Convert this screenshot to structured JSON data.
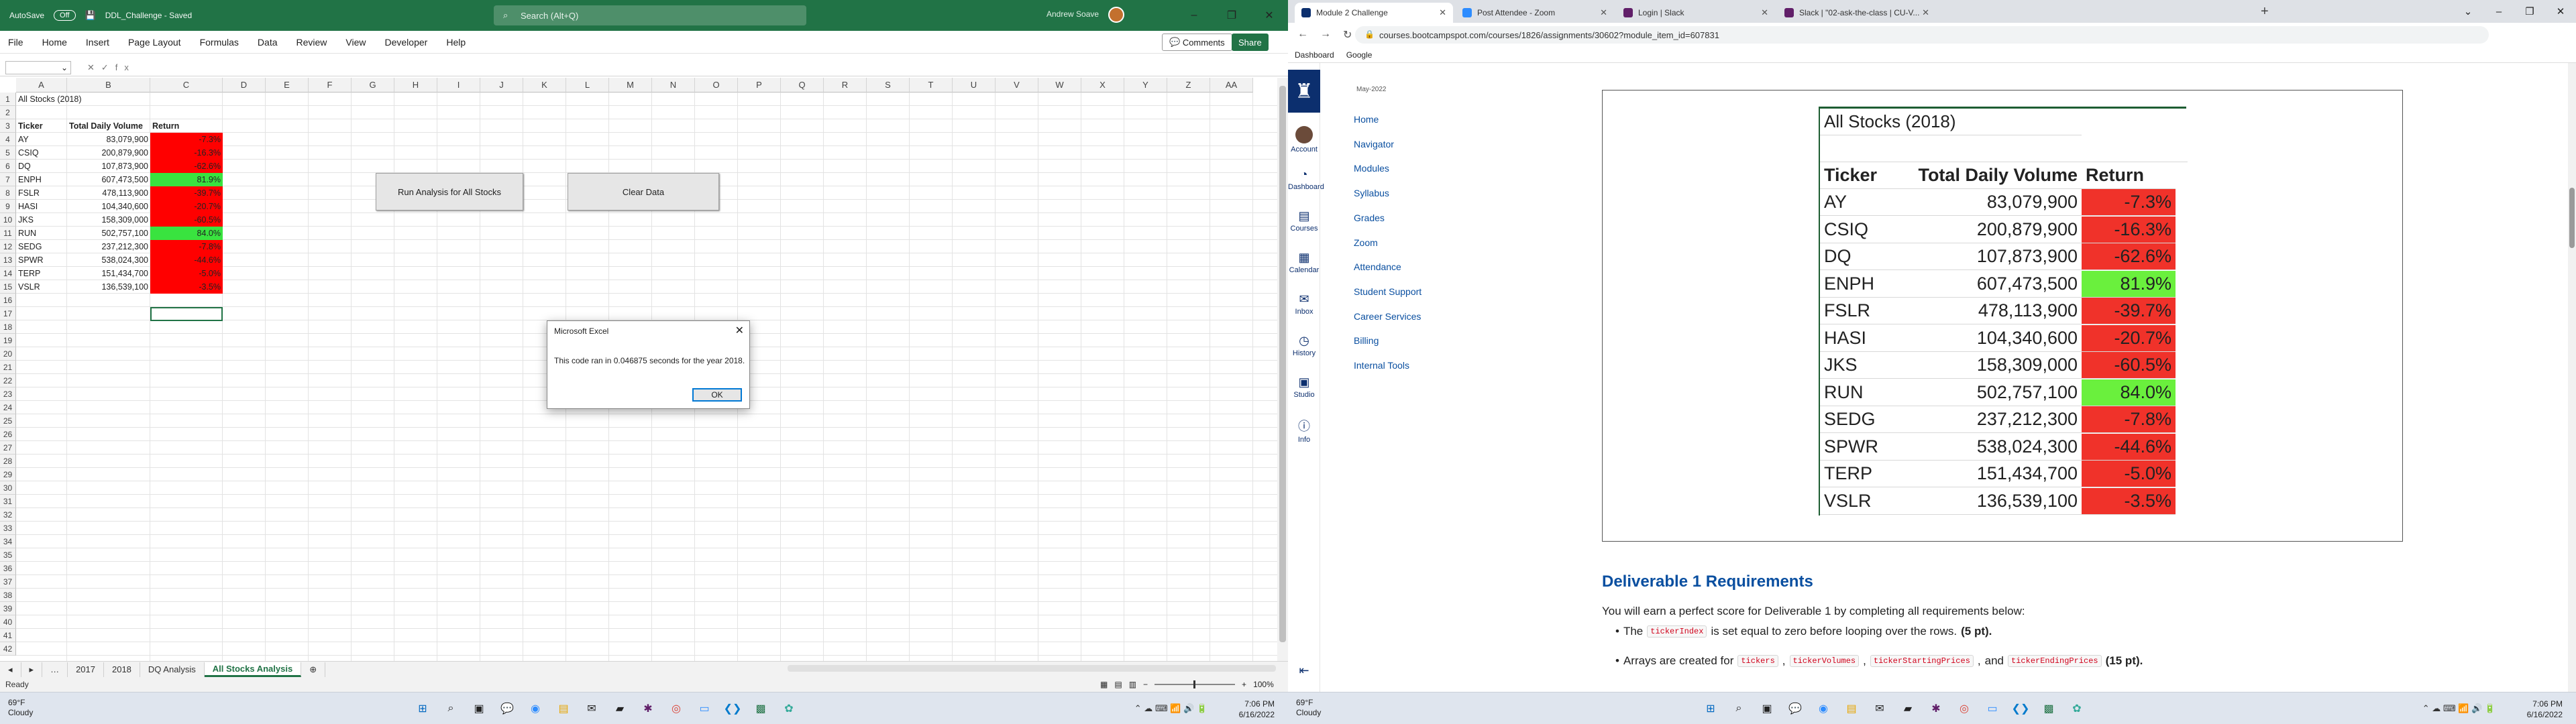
{
  "excel": {
    "autosave_label": "AutoSave",
    "autosave_state": "Off",
    "filename": "DDL_Challenge - Saved",
    "search_placeholder": "Search (Alt+Q)",
    "user_name": "Andrew Soave",
    "menu": [
      "File",
      "Home",
      "Insert",
      "Page Layout",
      "Formulas",
      "Data",
      "Review",
      "View",
      "Developer",
      "Help"
    ],
    "comments_label": "Comments",
    "share_label": "Share",
    "fx_label": "fx",
    "columns": [
      "A",
      "B",
      "C",
      "D",
      "E",
      "F",
      "G",
      "H",
      "I",
      "J",
      "K",
      "L",
      "M",
      "N",
      "O",
      "P",
      "Q",
      "R",
      "S",
      "T",
      "U",
      "V",
      "W",
      "X",
      "Y",
      "Z",
      "AA"
    ],
    "rows": [
      "1",
      "2",
      "3",
      "4",
      "5",
      "6",
      "7",
      "8",
      "9",
      "10",
      "11",
      "12",
      "13",
      "14",
      "15",
      "16",
      "17",
      "18",
      "19",
      "20",
      "21",
      "22",
      "23",
      "24",
      "25",
      "26",
      "27",
      "28",
      "29",
      "30",
      "31",
      "32",
      "33",
      "34",
      "35",
      "36",
      "37",
      "38",
      "39",
      "40",
      "41",
      "42"
    ],
    "sheet_title": "All Stocks (2018)",
    "headers": {
      "ticker": "Ticker",
      "volume": "Total Daily Volume",
      "return": "Return"
    },
    "table": [
      {
        "ticker": "AY",
        "volume": "83,079,900",
        "return": "-7.3%",
        "positive": false
      },
      {
        "ticker": "CSIQ",
        "volume": "200,879,900",
        "return": "-16.3%",
        "positive": false
      },
      {
        "ticker": "DQ",
        "volume": "107,873,900",
        "return": "-62.6%",
        "positive": false
      },
      {
        "ticker": "ENPH",
        "volume": "607,473,500",
        "return": "81.9%",
        "positive": true
      },
      {
        "ticker": "FSLR",
        "volume": "478,113,900",
        "return": "-39.7%",
        "positive": false
      },
      {
        "ticker": "HASI",
        "volume": "104,340,600",
        "return": "-20.7%",
        "positive": false
      },
      {
        "ticker": "JKS",
        "volume": "158,309,000",
        "return": "-60.5%",
        "positive": false
      },
      {
        "ticker": "RUN",
        "volume": "502,757,100",
        "return": "84.0%",
        "positive": true
      },
      {
        "ticker": "SEDG",
        "volume": "237,212,300",
        "return": "-7.8%",
        "positive": false
      },
      {
        "ticker": "SPWR",
        "volume": "538,024,300",
        "return": "-44.6%",
        "positive": false
      },
      {
        "ticker": "TERP",
        "volume": "151,434,700",
        "return": "-5.0%",
        "positive": false
      },
      {
        "ticker": "VSLR",
        "volume": "136,539,100",
        "return": "-3.5%",
        "positive": false
      }
    ],
    "btn_run": "Run Analysis for All Stocks",
    "btn_clear": "Clear Data",
    "dialog": {
      "title": "Microsoft Excel",
      "message": "This code ran in 0.046875 seconds for the year 2018.",
      "ok": "OK"
    },
    "sheet_tabs": [
      "2017",
      "2018",
      "DQ Analysis",
      "All Stocks Analysis"
    ],
    "active_tab": "All Stocks Analysis",
    "status": "Ready",
    "zoom": "100%"
  },
  "taskbar_left": {
    "temp": "69°F",
    "cond": "Cloudy",
    "time": "7:06 PM",
    "date": "6/16/2022"
  },
  "taskbar_right": {
    "temp": "69°F",
    "cond": "Cloudy",
    "time": "7:06 PM",
    "date": "6/16/2022"
  },
  "chrome": {
    "tabs": [
      {
        "title": "Module 2 Challenge",
        "color": "#0c2f6e"
      },
      {
        "title": "Post Attendee - Zoom",
        "color": "#2d8cff"
      },
      {
        "title": "Login | Slack",
        "color": "#611f69"
      },
      {
        "title": "Slack | \"02-ask-the-class | CU-V...",
        "color": "#611f69"
      }
    ],
    "url": "courses.bootcampspot.com/courses/1826/assignments/30602?module_item_id=607831",
    "bookmarks": [
      "Dashboard",
      "Google"
    ],
    "canvas_nav": [
      "Account",
      "Dashboard",
      "Courses",
      "Calendar",
      "Inbox",
      "History",
      "Studio",
      "Info"
    ],
    "course_date": "May-2022",
    "course_nav": [
      "Home",
      "Navigator",
      "Modules",
      "Syllabus",
      "Grades",
      "Zoom",
      "Attendance",
      "Student Support",
      "Career Services",
      "Billing",
      "Internal Tools"
    ],
    "embed_title": "All Stocks (2018)",
    "deliverable_heading": "Deliverable 1 Requirements",
    "requirements_intro": "You will earn a perfect score for Deliverable 1 by completing all requirements below:",
    "bullet1": {
      "pre": "The",
      "code": "tickerIndex",
      "post": "is set equal to zero before looping over the rows.",
      "pts": "(5 pt)."
    },
    "bullet2": {
      "pre": "Arrays are created for",
      "codes": [
        "tickers",
        "tickerVolumes",
        "tickerStartingPrices"
      ],
      "and": "and",
      "code_last": "tickerEndingPrices",
      "pts": "(15 pt)."
    }
  }
}
